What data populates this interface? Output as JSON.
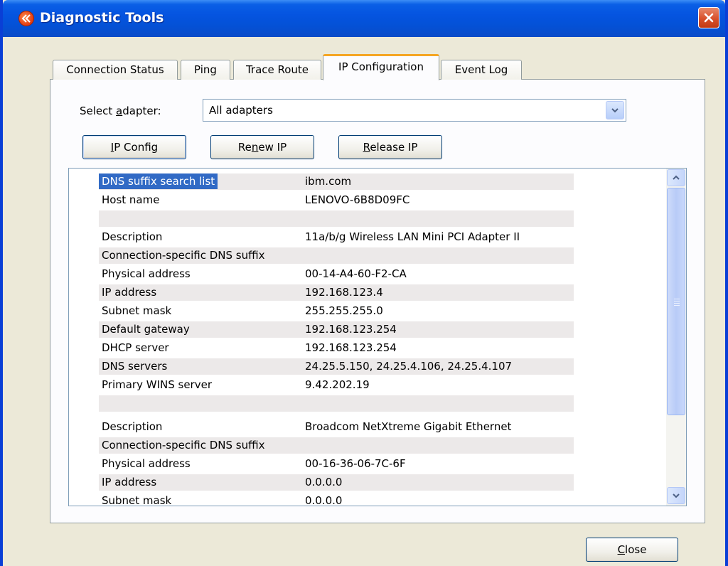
{
  "window": {
    "title": "Diagnostic Tools"
  },
  "tabs": [
    {
      "label": "Connection Status"
    },
    {
      "label": "Ping"
    },
    {
      "label": "Trace Route"
    },
    {
      "label": "IP Configuration",
      "active": true
    },
    {
      "label": "Event Log"
    }
  ],
  "adapter": {
    "label_pre": "Select ",
    "label_mn": "a",
    "label_post": "dapter:",
    "value": "All adapters"
  },
  "buttons": {
    "ipconfig": {
      "mn": "I",
      "rest": "P Config"
    },
    "renew": {
      "pre": "Re",
      "mn": "n",
      "post": "ew IP"
    },
    "release": {
      "mn": "R",
      "rest": "elease IP"
    },
    "close": {
      "mn": "C",
      "rest": "lose"
    }
  },
  "rows": [
    {
      "key": "DNS suffix search list",
      "value": "ibm.com"
    },
    {
      "key": "Host name",
      "value": "LENOVO-6B8D09FC"
    },
    {
      "key": "",
      "value": ""
    },
    {
      "key": "Description",
      "value": "11a/b/g Wireless LAN Mini PCI Adapter II"
    },
    {
      "key": "Connection-specific DNS suffix",
      "value": ""
    },
    {
      "key": "Physical address",
      "value": "00-14-A4-60-F2-CA"
    },
    {
      "key": "IP address",
      "value": "192.168.123.4"
    },
    {
      "key": "Subnet mask",
      "value": "255.255.255.0"
    },
    {
      "key": "Default gateway",
      "value": "192.168.123.254"
    },
    {
      "key": "DHCP server",
      "value": "192.168.123.254"
    },
    {
      "key": "DNS servers",
      "value": "24.25.5.150, 24.25.4.106, 24.25.4.107"
    },
    {
      "key": "Primary WINS server",
      "value": "9.42.202.19"
    },
    {
      "key": "",
      "value": ""
    },
    {
      "key": "Description",
      "value": "Broadcom NetXtreme Gigabit Ethernet"
    },
    {
      "key": "Connection-specific DNS suffix",
      "value": ""
    },
    {
      "key": "Physical address",
      "value": "00-16-36-06-7C-6F"
    },
    {
      "key": "IP address",
      "value": "0.0.0.0"
    },
    {
      "key": "Subnet mask",
      "value": "0.0.0.0"
    }
  ],
  "colors": {
    "titlebar": "#0554e0",
    "selection": "#316ac5",
    "active_tab_accent": "#f5a623",
    "row_shade": "#ece9e9"
  }
}
